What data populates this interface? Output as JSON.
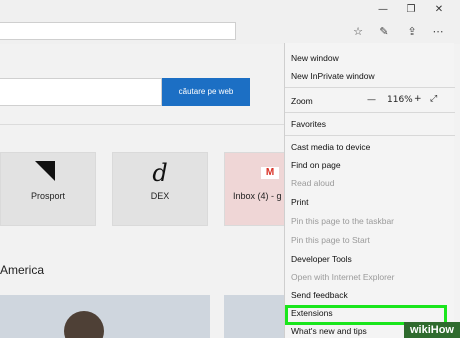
{
  "titlebar": {
    "minimize_icon": "minimize-icon",
    "restore_icon": "restore-icon",
    "close_icon": "close-icon"
  },
  "toolbar": {
    "icons": [
      "favorites-star-icon",
      "web-note-icon",
      "share-icon",
      "more-icon"
    ]
  },
  "page": {
    "search_button": "căutare pe web",
    "tiles": [
      "Prosport",
      "DEX",
      "Inbox (4) - g"
    ],
    "section_title": "America"
  },
  "menu": {
    "items": [
      {
        "label": "New window",
        "enabled": true
      },
      {
        "label": "New InPrivate window",
        "enabled": true
      },
      {
        "label": "Favorites",
        "enabled": true
      },
      {
        "label": "Cast media to device",
        "enabled": true
      },
      {
        "label": "Find on page",
        "enabled": true
      },
      {
        "label": "Read aloud",
        "enabled": false
      },
      {
        "label": "Print",
        "enabled": true
      },
      {
        "label": "Pin this page to the taskbar",
        "enabled": false
      },
      {
        "label": "Pin this page to Start",
        "enabled": false
      },
      {
        "label": "Developer Tools",
        "enabled": true
      },
      {
        "label": "Open with Internet Explorer",
        "enabled": false
      },
      {
        "label": "Send feedback",
        "enabled": true
      },
      {
        "label": "Extensions",
        "enabled": true
      },
      {
        "label": "What's new and tips",
        "enabled": true
      }
    ],
    "zoom": {
      "label": "Zoom",
      "minus": "—",
      "value": "116%",
      "plus": "+"
    }
  },
  "highlight_color": "#19e61c",
  "watermark": "wikiHow"
}
